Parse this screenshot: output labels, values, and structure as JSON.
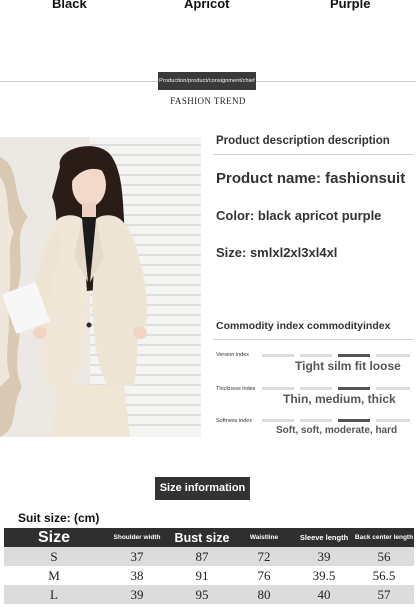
{
  "colors_row": [
    "Black",
    "Apricot",
    "Purple"
  ],
  "banner": {
    "text": "Production/product/consignment/chief",
    "subtitle": "FASHION TREND"
  },
  "description": {
    "heading": "Product description description",
    "product_name": "Product name: fashionsuit",
    "color": "Color: black apricot purple",
    "size": "Size: smlxl2xl3xl4xl"
  },
  "commodity": {
    "heading": "Commodity index commodityindex",
    "version": {
      "label": "Version index",
      "values": "Tight silm fit loose",
      "active_index": 2
    },
    "thickness": {
      "label": "Thickness index",
      "values": "Thin, medium, thick",
      "active_index": 2
    },
    "softness": {
      "label": "Softness index",
      "values": "Soft, soft, moderate, hard",
      "active_index": 2
    }
  },
  "size_info_button": "Size information",
  "suit_size_label": "Suit size: (cm)",
  "table": {
    "headers": [
      "Size",
      "Shoulder width",
      "Bust size",
      "Waistline",
      "Sleeve length",
      "Back center length"
    ],
    "rows": [
      [
        "S",
        "37",
        "87",
        "72",
        "39",
        "56"
      ],
      [
        "M",
        "38",
        "91",
        "76",
        "39.5",
        "56.5"
      ],
      [
        "L",
        "39",
        "95",
        "80",
        "40",
        "57"
      ]
    ]
  },
  "palette": {
    "dark": "#333333",
    "row_gray": "#dcdcdc",
    "apricot": "#efe6d6"
  }
}
